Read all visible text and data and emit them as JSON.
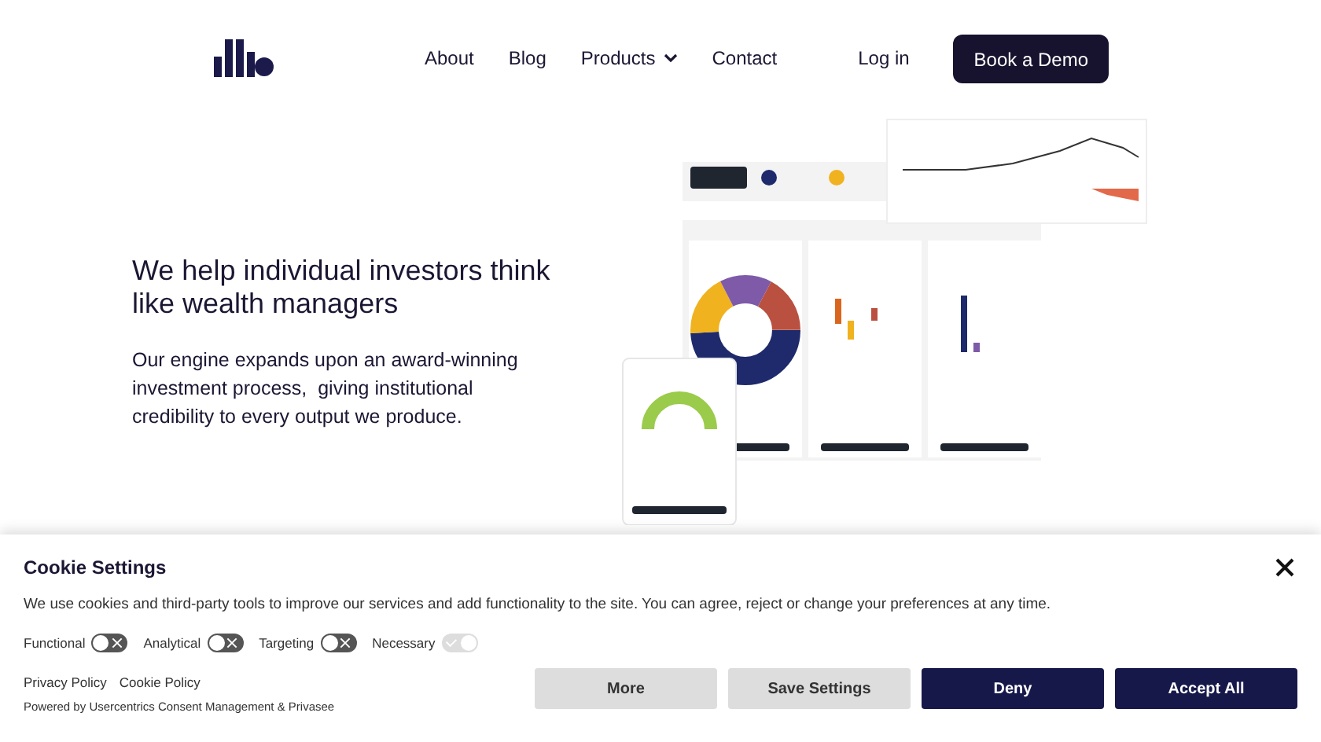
{
  "nav": {
    "links": [
      {
        "label": "About",
        "has_menu": false
      },
      {
        "label": "Blog",
        "has_menu": false
      },
      {
        "label": "Products",
        "has_menu": true
      },
      {
        "label": "Contact",
        "has_menu": false
      }
    ],
    "login": "Log in",
    "cta": "Book a Demo"
  },
  "hero": {
    "headline": "We help individual investors think like wealth managers",
    "body": "Our engine expands upon an award-winning investment process,  giving institutional credibility to every output we produce."
  },
  "cookie_banner": {
    "title": "Cookie Settings",
    "description": "We use cookies and third-party tools to improve our services and add functionality to the site. You can agree, reject or change your preferences at any time.",
    "toggles": [
      {
        "label": "Functional",
        "on": false,
        "disabled": false
      },
      {
        "label": "Analytical",
        "on": false,
        "disabled": false
      },
      {
        "label": "Targeting",
        "on": false,
        "disabled": false
      },
      {
        "label": "Necessary",
        "on": true,
        "disabled": true
      }
    ],
    "links": [
      "Privacy Policy",
      "Cookie Policy"
    ],
    "powered_by": "Powered by Usercentrics Consent Management & Privasee",
    "buttons": [
      {
        "label": "More",
        "kind": "secondary"
      },
      {
        "label": "Save Settings",
        "kind": "secondary"
      },
      {
        "label": "Deny",
        "kind": "primary"
      },
      {
        "label": "Accept All",
        "kind": "primary"
      }
    ]
  }
}
